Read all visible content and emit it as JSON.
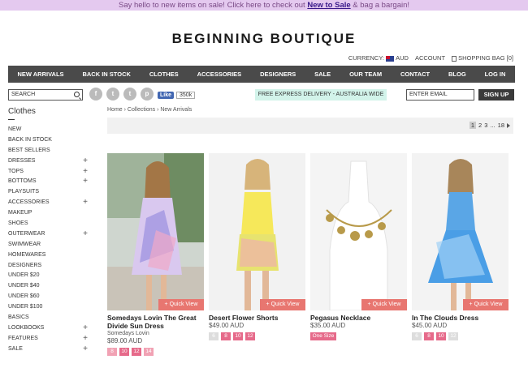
{
  "promo": {
    "text_before": "Say hello to new items on sale! Click here to check out ",
    "link": "New to Sale",
    "text_after": " & bag a bargain!"
  },
  "logo": "BEGINNING BOUTIQUE",
  "topbar": {
    "currency_label": "CURRENCY:",
    "currency_value": "AUD",
    "account": "ACCOUNT",
    "bag": "SHOPPING BAG [0]"
  },
  "nav": [
    "NEW ARRIVALS",
    "BACK IN STOCK",
    "CLOTHES",
    "ACCESSORIES",
    "DESIGNERS",
    "SALE",
    "OUR TEAM",
    "CONTACT",
    "BLOG",
    "LOG IN"
  ],
  "search": {
    "placeholder": "SEARCH"
  },
  "social": [
    "f",
    "t",
    "t",
    "p"
  ],
  "fb": {
    "like": "Like",
    "count": "350k"
  },
  "shipping": "FREE EXPRESS DELIVERY - AUSTRALIA WIDE",
  "newsletter": {
    "placeholder": "ENTER EMAIL",
    "button": "SIGN UP"
  },
  "sidebar": {
    "title": "Clothes",
    "items": [
      {
        "label": "NEW",
        "plus": ""
      },
      {
        "label": "BACK IN STOCK",
        "plus": ""
      },
      {
        "label": "BEST SELLERS",
        "plus": ""
      },
      {
        "label": "DRESSES",
        "plus": "+"
      },
      {
        "label": "TOPS",
        "plus": "+"
      },
      {
        "label": "BOTTOMS",
        "plus": "+"
      },
      {
        "label": "PLAYSUITS",
        "plus": ""
      },
      {
        "label": "ACCESSORIES",
        "plus": "+"
      },
      {
        "label": "MAKEUP",
        "plus": ""
      },
      {
        "label": "SHOES",
        "plus": ""
      },
      {
        "label": "OUTERWEAR",
        "plus": "+"
      },
      {
        "label": "SWIMWEAR",
        "plus": ""
      },
      {
        "label": "HOMEWARES",
        "plus": ""
      },
      {
        "label": "DESIGNERS",
        "plus": ""
      },
      {
        "label": "UNDER $20",
        "plus": ""
      },
      {
        "label": "UNDER $40",
        "plus": ""
      },
      {
        "label": "UNDER $60",
        "plus": ""
      },
      {
        "label": "UNDER $100",
        "plus": ""
      },
      {
        "label": "BASICS",
        "plus": ""
      },
      {
        "label": "LOOKBOOKS",
        "plus": "+"
      },
      {
        "label": "FEATURES",
        "plus": "+"
      },
      {
        "label": "SALE",
        "plus": "+"
      }
    ]
  },
  "breadcrumb": "Home › Collections › New Arrivals",
  "pager": {
    "current": "1",
    "pages": [
      "2",
      "3",
      "...",
      "18"
    ]
  },
  "quick_view": "+ Quick View",
  "products": [
    {
      "name": "Somedays Lovin The Great Divide Sun Dress",
      "brand": "Somedays Lovin",
      "price": "$89.00 AUD",
      "sizes": [
        {
          "s": "8",
          "st": "light"
        },
        {
          "s": "10",
          "st": "on"
        },
        {
          "s": "12",
          "st": "on"
        },
        {
          "s": "14",
          "st": "light"
        }
      ]
    },
    {
      "name": "Desert Flower Shorts",
      "brand": "",
      "price": "$49.00 AUD",
      "sizes": [
        {
          "s": "6",
          "st": "gone"
        },
        {
          "s": "8",
          "st": "on"
        },
        {
          "s": "10",
          "st": "on"
        },
        {
          "s": "12",
          "st": "on"
        }
      ]
    },
    {
      "name": "Pegasus Necklace",
      "brand": "",
      "price": "$35.00 AUD",
      "sizes": [
        {
          "s": "One Size",
          "st": "onesize"
        }
      ]
    },
    {
      "name": "In The Clouds Dress",
      "brand": "",
      "price": "$45.00 AUD",
      "sizes": [
        {
          "s": "6",
          "st": "gone"
        },
        {
          "s": "8",
          "st": "on"
        },
        {
          "s": "10",
          "st": "on"
        },
        {
          "s": "12",
          "st": "gone"
        }
      ]
    }
  ]
}
